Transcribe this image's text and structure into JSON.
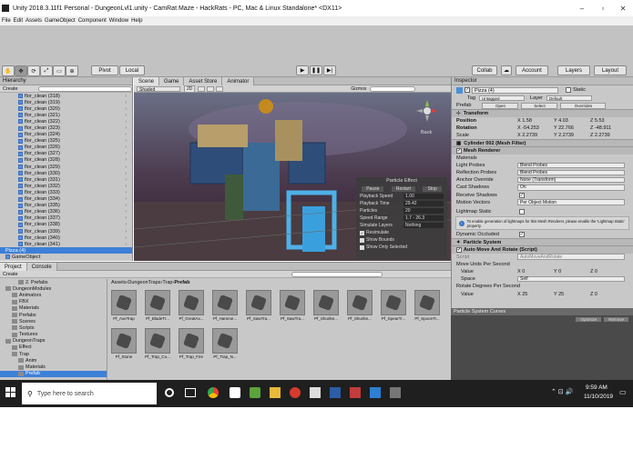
{
  "window": {
    "title": "Unity 2018.3.11f1 Personal - DungeonLvl1.unity - CamRat Maze - HackRats - PC, Mac & Linux Standalone* <DX11>"
  },
  "menu": [
    "File",
    "Edit",
    "Assets",
    "GameObject",
    "Component",
    "Window",
    "Help"
  ],
  "toolbar": {
    "pivot": "Pivot",
    "local": "Local",
    "collab": "Collab",
    "account": "Account",
    "layers": "Layers",
    "layout": "Layout"
  },
  "hierarchy": {
    "tab": "Hierarchy",
    "create": "Create",
    "items": [
      "flor_clean (318)",
      "flor_clean (319)",
      "flor_clean (320)",
      "flor_clean (321)",
      "flor_clean (322)",
      "flor_clean (323)",
      "flor_clean (324)",
      "flor_clean (325)",
      "flor_clean (326)",
      "flor_clean (327)",
      "flor_clean (328)",
      "flor_clean (329)",
      "flor_clean (330)",
      "flor_clean (331)",
      "flor_clean (332)",
      "flor_clean (333)",
      "flor_clean (334)",
      "flor_clean (335)",
      "flor_clean (336)",
      "flor_clean (337)",
      "flor_clean (338)",
      "flor_clean (339)",
      "flor_clean (340)",
      "flor_clean (341)"
    ],
    "selected": "Pizza (4)",
    "gameobject": "GameObject"
  },
  "scene_tabs": [
    "Scene",
    "Game",
    "Asset Store",
    "Animator"
  ],
  "scene": {
    "shading": "Shaded",
    "mode_2d": "2D",
    "gizmos": "Gizmos",
    "back": "Back",
    "particle_effect": {
      "title": "Particle Effect",
      "buttons": [
        "Pause",
        "Restart",
        "Stop"
      ],
      "rows": [
        {
          "label": "Playback Speed",
          "value": "1.00"
        },
        {
          "label": "Playback Time",
          "value": "29.42"
        },
        {
          "label": "Particles",
          "value": "20"
        },
        {
          "label": "Speed Range",
          "value": "1.7 - 26.3"
        },
        {
          "label": "Simulate Layers",
          "value": "Nothing"
        }
      ],
      "checks": [
        "Resimulate",
        "Show Bounds",
        "Show Only Selected"
      ]
    }
  },
  "inspector": {
    "tab": "Inspector",
    "object_name": "Pizza (4)",
    "static": "Static",
    "tag_label": "Tag",
    "tag": "Untagged",
    "layer_label": "Layer",
    "layer": "Default",
    "prefab_label": "Prefab",
    "prefab_buttons": [
      "Open",
      "Select",
      "Overrides"
    ],
    "transform": "Transform",
    "position": {
      "label": "Position",
      "x": "1.58",
      "y": "4.03",
      "z": "5.53"
    },
    "rotation": {
      "label": "Rotation",
      "x": "-54.253",
      "y": "22.766",
      "z": "-48.911"
    },
    "scale": {
      "label": "Scale",
      "x": "2.2739",
      "y": "2.2739",
      "z": "2.2739"
    },
    "mesh_filter": "Cylinder 002 (Mesh Filter)",
    "mesh_renderer": "Mesh Renderer",
    "materials": "Materials",
    "light_probes": {
      "label": "Light Probes",
      "value": "Blend Probes"
    },
    "reflection_probes": {
      "label": "Reflection Probes",
      "value": "Blend Probes"
    },
    "anchor_override": {
      "label": "Anchor Override",
      "value": "None (Transform)"
    },
    "cast_shadows": {
      "label": "Cast Shadows",
      "value": "On"
    },
    "receive_shadows": "Receive Shadows",
    "motion_vectors": {
      "label": "Motion Vectors",
      "value": "Per Object Motion"
    },
    "lightmap_static": "Lightmap Static",
    "lightmap_note": "To enable generation of lightmaps for this Mesh Renderer, please enable the 'Lightmap Static' property.",
    "dynamic_occluded": "Dynamic Occluded",
    "particle_system": "Particle System",
    "auto_move": "Auto Move And Rotate (Script)",
    "script_label": "Script",
    "script_value": "AutoMoveAndRotate",
    "move_units": "Move Units Per Second",
    "value_label": "Value",
    "move_x": "0",
    "move_y": "0",
    "move_z": "0",
    "space_label": "Space",
    "space_value": "Self",
    "rotate_degrees": "Rotate Degrees Per Second",
    "rot_x": "25",
    "rot_y": "25",
    "rot_z": "0"
  },
  "curves": {
    "title": "Particle System Curves",
    "optimize": "Optimize",
    "remove": "Remove"
  },
  "project": {
    "tabs": [
      "Project",
      "Console"
    ],
    "create": "Create",
    "tree": [
      "2. Prefabs",
      "DungeonModules",
      "Animators",
      "FBX",
      "Materials",
      "Prefabs",
      "Scenes",
      "Scripts",
      "Textures",
      "DungeonTraps",
      "Effect",
      "Trap",
      "Anim",
      "Materials",
      "Prefab"
    ],
    "breadcrumb": [
      "Assets",
      "DungeonTraps",
      "Trap",
      "Prefab"
    ],
    "assets_row1": [
      "Pf_AxeTrap",
      "Pf_BladeTr...",
      "Pf_GreatAx...",
      "Pf_Hamme...",
      "Pf_SawTra...",
      "Pf_SawTra...",
      "Pf_Shurike...",
      "Pf_Shurike...",
      "Pf_SpearTr...",
      "Pf_SpoonTr..."
    ],
    "assets_row2": [
      "Pf_Stone",
      "Pf_Trap_Cu...",
      "Pf_Trap_Fire",
      "Pf_Trap_N..."
    ]
  },
  "taskbar": {
    "search": "Type here to search",
    "time": "9:59 AM",
    "date": "11/10/2019"
  }
}
